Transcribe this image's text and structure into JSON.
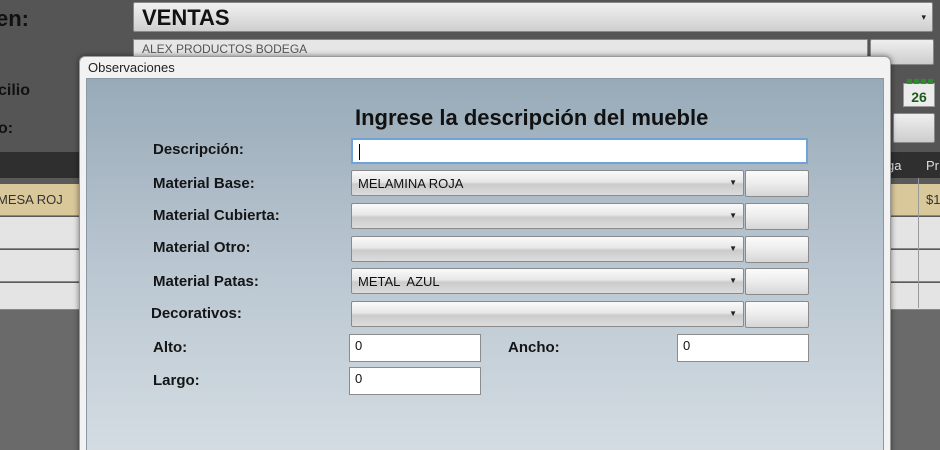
{
  "background": {
    "labels": [
      "en:",
      "cilio",
      "o:"
    ],
    "section_combo": "VENTAS",
    "field_text": "ALEX PRODUCTOS BODEGA",
    "counter": "26",
    "grid_headers": [
      "ga",
      "Pr"
    ],
    "row_text": "MESA ROJ",
    "row_price": "$1"
  },
  "dialog": {
    "title": "Observaciones",
    "heading": "Ingrese la descripción del mueble",
    "fields": {
      "descripcion": {
        "label": "Descripción:",
        "value": ""
      },
      "material_base": {
        "label": "Material Base:",
        "value": "MELAMINA ROJA"
      },
      "material_cubierta": {
        "label": "Material Cubierta:",
        "value": ""
      },
      "material_otro": {
        "label": "Material Otro:",
        "value": ""
      },
      "material_patas": {
        "label": "Material Patas:",
        "value": "METAL  AZUL"
      },
      "decorativos": {
        "label": "Decorativos:",
        "value": ""
      },
      "alto": {
        "label": "Alto:",
        "value": "0"
      },
      "ancho": {
        "label": "Ancho:",
        "value": "0"
      },
      "largo": {
        "label": "Largo:",
        "value": "0"
      }
    },
    "dropdown_icon": "chevron-down-icon"
  },
  "colors": {
    "panel_top": "#98aab8",
    "panel_bottom": "#d5dde3",
    "focus_border": "#6fa3d8",
    "selected_row": "#d9c89a"
  }
}
